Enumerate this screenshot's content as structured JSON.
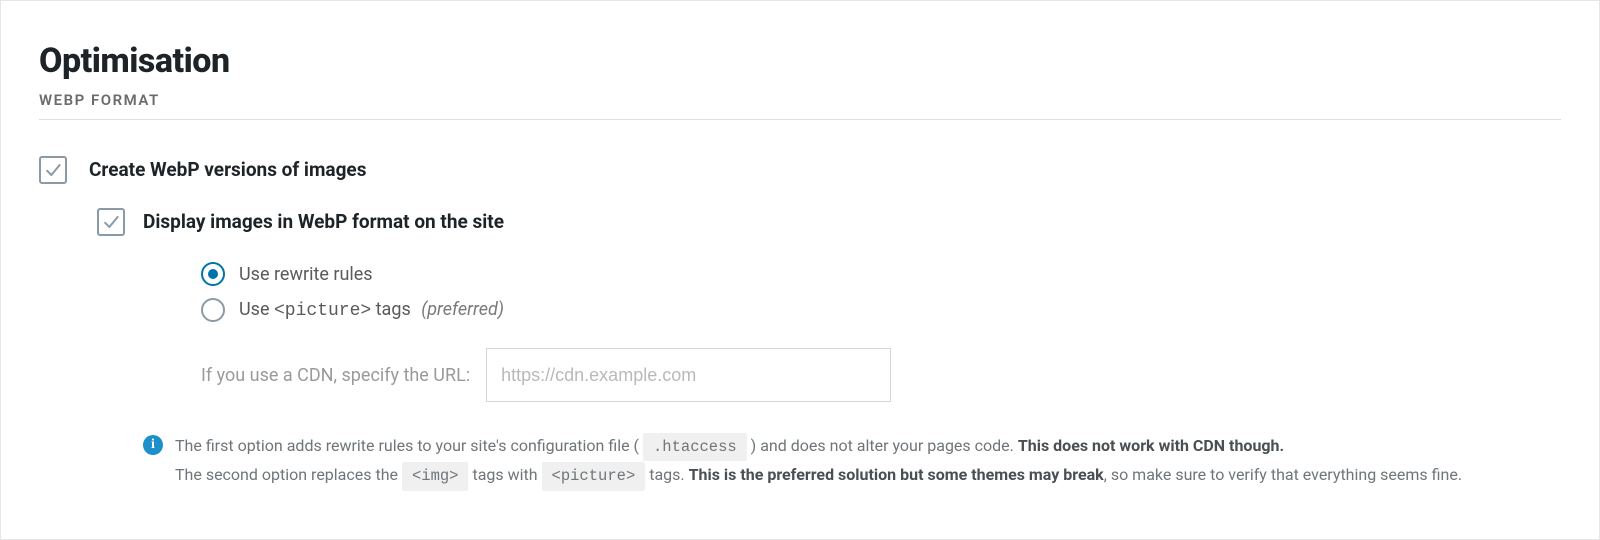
{
  "header": {
    "title": "Optimisation",
    "subtitle": "WEBP FORMAT"
  },
  "opt_create_webp": {
    "label": "Create WebP versions of images",
    "checked": true
  },
  "opt_display_webp": {
    "label": "Display images in WebP format on the site",
    "checked": true
  },
  "radio": {
    "rewrite": {
      "label": "Use rewrite rules",
      "selected": true
    },
    "picture": {
      "label_prefix": "Use ",
      "label_code": "<picture>",
      "label_after": " tags",
      "label_suffix": "(preferred)",
      "selected": false
    }
  },
  "cdn": {
    "label": "If you use a CDN, specify the URL:",
    "placeholder": "https://cdn.example.com",
    "value": ""
  },
  "info": {
    "line1_a": "The first option adds rewrite rules to your site's configuration file ( ",
    "code1": ".htaccess",
    "line1_b": " ) and does not alter your pages code. ",
    "line1_strong": "This does not work with CDN though.",
    "line2_a": "The second option replaces the ",
    "code2": "<img>",
    "line2_b": " tags with ",
    "code3": "<picture>",
    "line2_c": " tags. ",
    "line2_strong": "This is the preferred solution but some themes may break",
    "line2_d": ", so make sure to verify that everything seems fine."
  }
}
